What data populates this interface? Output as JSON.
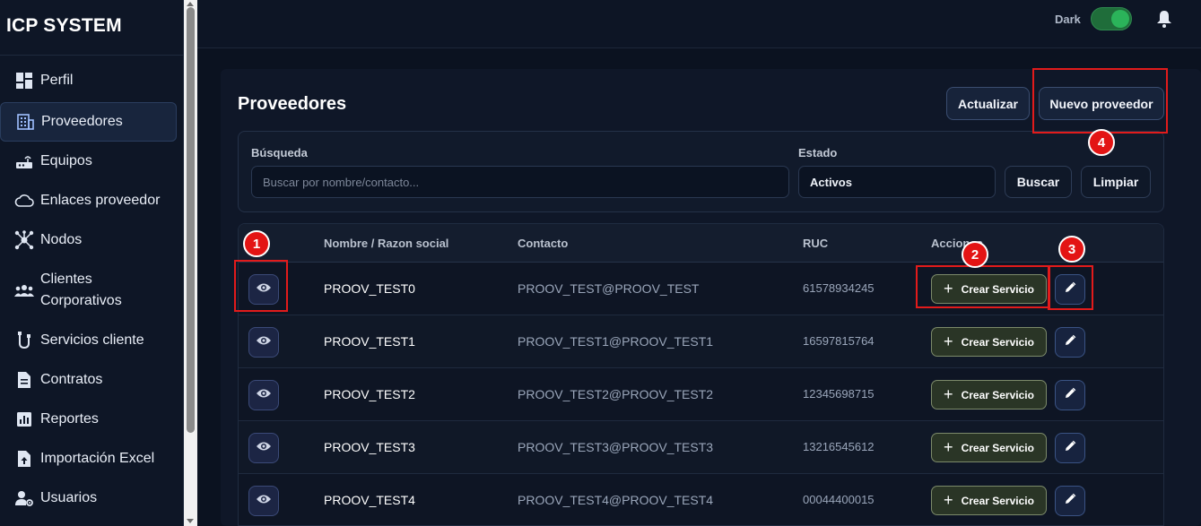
{
  "app": {
    "title": "ICP SYSTEM"
  },
  "sidebar": {
    "items": [
      {
        "label": "Perfil",
        "icon": "dashboard-icon"
      },
      {
        "label": "Proveedores",
        "icon": "building-icon",
        "active": true
      },
      {
        "label": "Equipos",
        "icon": "router-icon"
      },
      {
        "label": "Enlaces proveedor",
        "icon": "cloud-icon"
      },
      {
        "label": "Nodos",
        "icon": "hub-icon"
      },
      {
        "label": "Clientes\nCorporativos",
        "icon": "groups-icon"
      },
      {
        "label": "Servicios cliente",
        "icon": "cable-icon"
      },
      {
        "label": "Contratos",
        "icon": "document-icon"
      },
      {
        "label": "Reportes",
        "icon": "bar-chart-icon"
      },
      {
        "label": "Importación Excel",
        "icon": "upload-file-icon"
      },
      {
        "label": "Usuarios",
        "icon": "manage-users-icon"
      }
    ]
  },
  "topbar": {
    "theme_label": "Dark",
    "theme_on": true
  },
  "main": {
    "title": "Proveedores",
    "update_label": "Actualizar",
    "new_label": "Nuevo proveedor"
  },
  "filters": {
    "search_label": "Búsqueda",
    "search_placeholder": "Buscar por nombre/contacto...",
    "estado_label": "Estado",
    "estado_value": "Activos",
    "buscar_label": "Buscar",
    "limpiar_label": "Limpiar"
  },
  "table": {
    "headers": [
      "Nombre / Razon social",
      "Contacto",
      "RUC",
      "Acciones"
    ],
    "service_label": "Crear Servicio",
    "rows": [
      {
        "name": "PROOV_TEST0",
        "contact": "PROOV_TEST@PROOV_TEST",
        "ruc": "61578934245"
      },
      {
        "name": "PROOV_TEST1",
        "contact": "PROOV_TEST1@PROOV_TEST1",
        "ruc": "16597815764"
      },
      {
        "name": "PROOV_TEST2",
        "contact": "PROOV_TEST2@PROOV_TEST2",
        "ruc": "12345698715"
      },
      {
        "name": "PROOV_TEST3",
        "contact": "PROOV_TEST3@PROOV_TEST3",
        "ruc": "13216545612"
      },
      {
        "name": "PROOV_TEST4",
        "contact": "PROOV_TEST4@PROOV_TEST4",
        "ruc": "00044400015"
      }
    ]
  },
  "annotations": [
    "1",
    "2",
    "3",
    "4"
  ],
  "colors": {
    "accent_red": "#e21b1b",
    "toggle_green": "#2bb35a",
    "background": "#0b1220"
  }
}
